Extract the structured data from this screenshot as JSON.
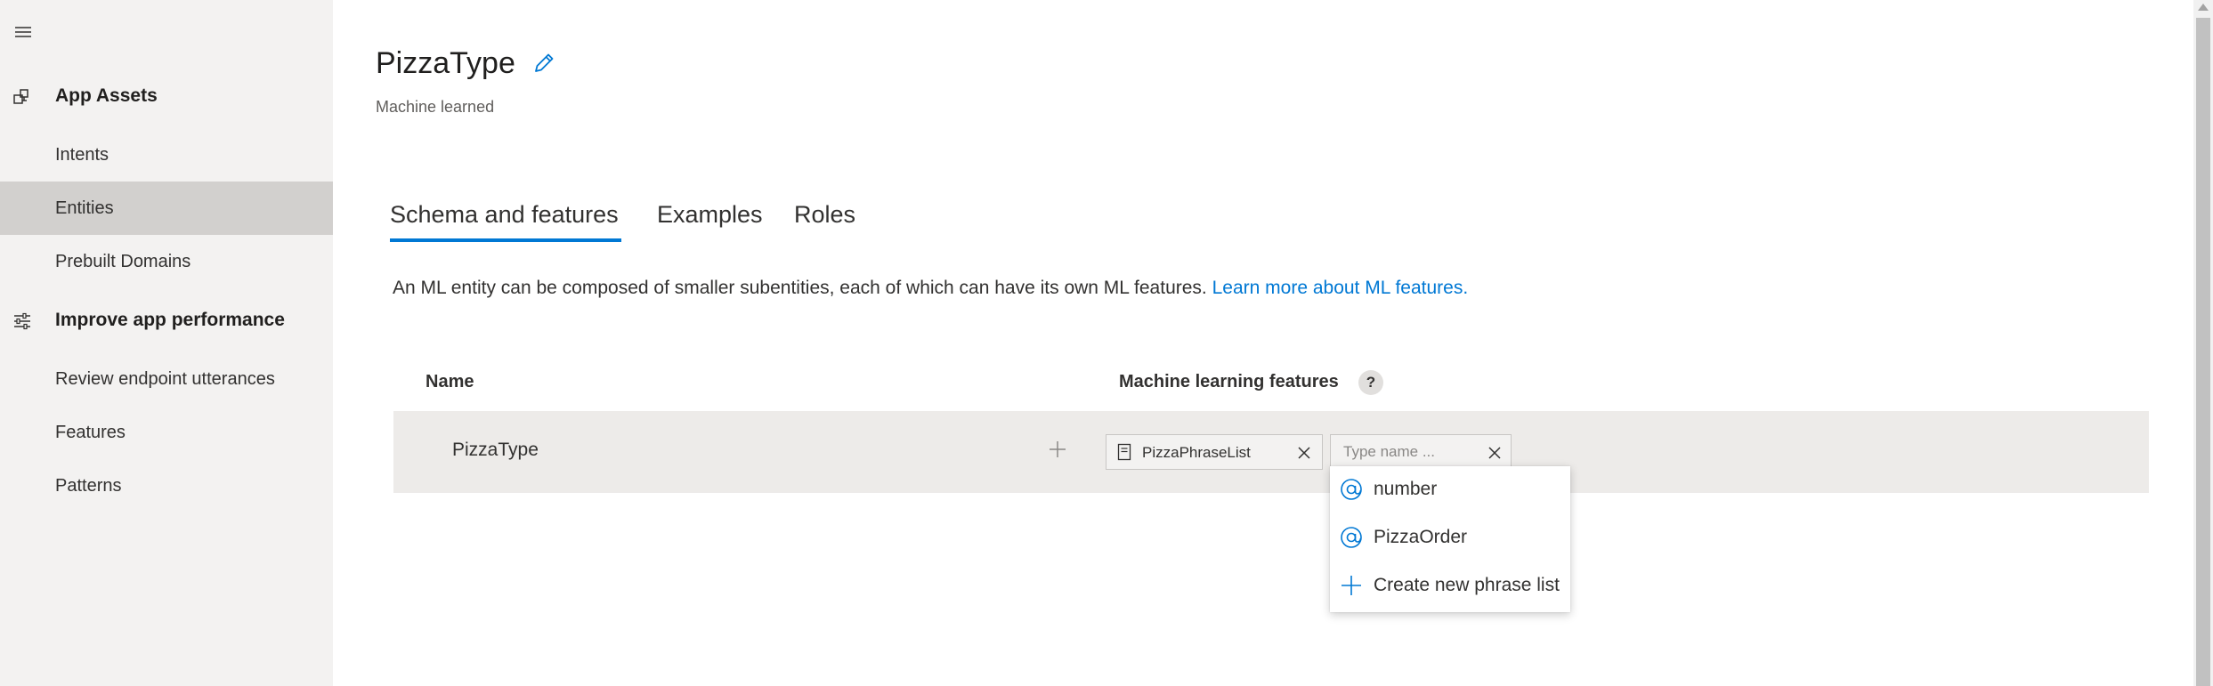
{
  "sidebar": {
    "groups": [
      {
        "label": "App Assets",
        "icon": "app-assets-icon",
        "items": [
          {
            "label": "Intents"
          },
          {
            "label": "Entities",
            "active": true
          },
          {
            "label": "Prebuilt Domains"
          }
        ]
      },
      {
        "label": "Improve app performance",
        "icon": "sliders-icon",
        "items": [
          {
            "label": "Review endpoint utterances"
          },
          {
            "label": "Features"
          },
          {
            "label": "Patterns"
          }
        ]
      }
    ]
  },
  "header": {
    "title": "PizzaType",
    "subtitle": "Machine learned"
  },
  "tabs": [
    {
      "label": "Schema and features",
      "selected": true
    },
    {
      "label": "Examples"
    },
    {
      "label": "Roles"
    }
  ],
  "description": {
    "text": "An ML entity can be composed of smaller subentities, each of which can have its own ML features.",
    "link": "Learn more about ML features."
  },
  "table": {
    "columns": [
      "Name",
      "Machine learning features"
    ],
    "help": "?",
    "rows": [
      {
        "name": "PizzaType",
        "features": [
          "PizzaPhraseList"
        ],
        "input_placeholder": "Type name ..."
      }
    ]
  },
  "dropdown": {
    "items": [
      {
        "label": "number",
        "icon": "at-icon"
      },
      {
        "label": "PizzaOrder",
        "icon": "at-icon"
      },
      {
        "label": "Create new phrase list",
        "icon": "plus-icon"
      }
    ]
  },
  "colors": {
    "accent": "#0078d4",
    "sidebar_bg": "#f3f2f1",
    "active_item_bg": "#d2d0ce",
    "row_bg": "#edebe9"
  }
}
